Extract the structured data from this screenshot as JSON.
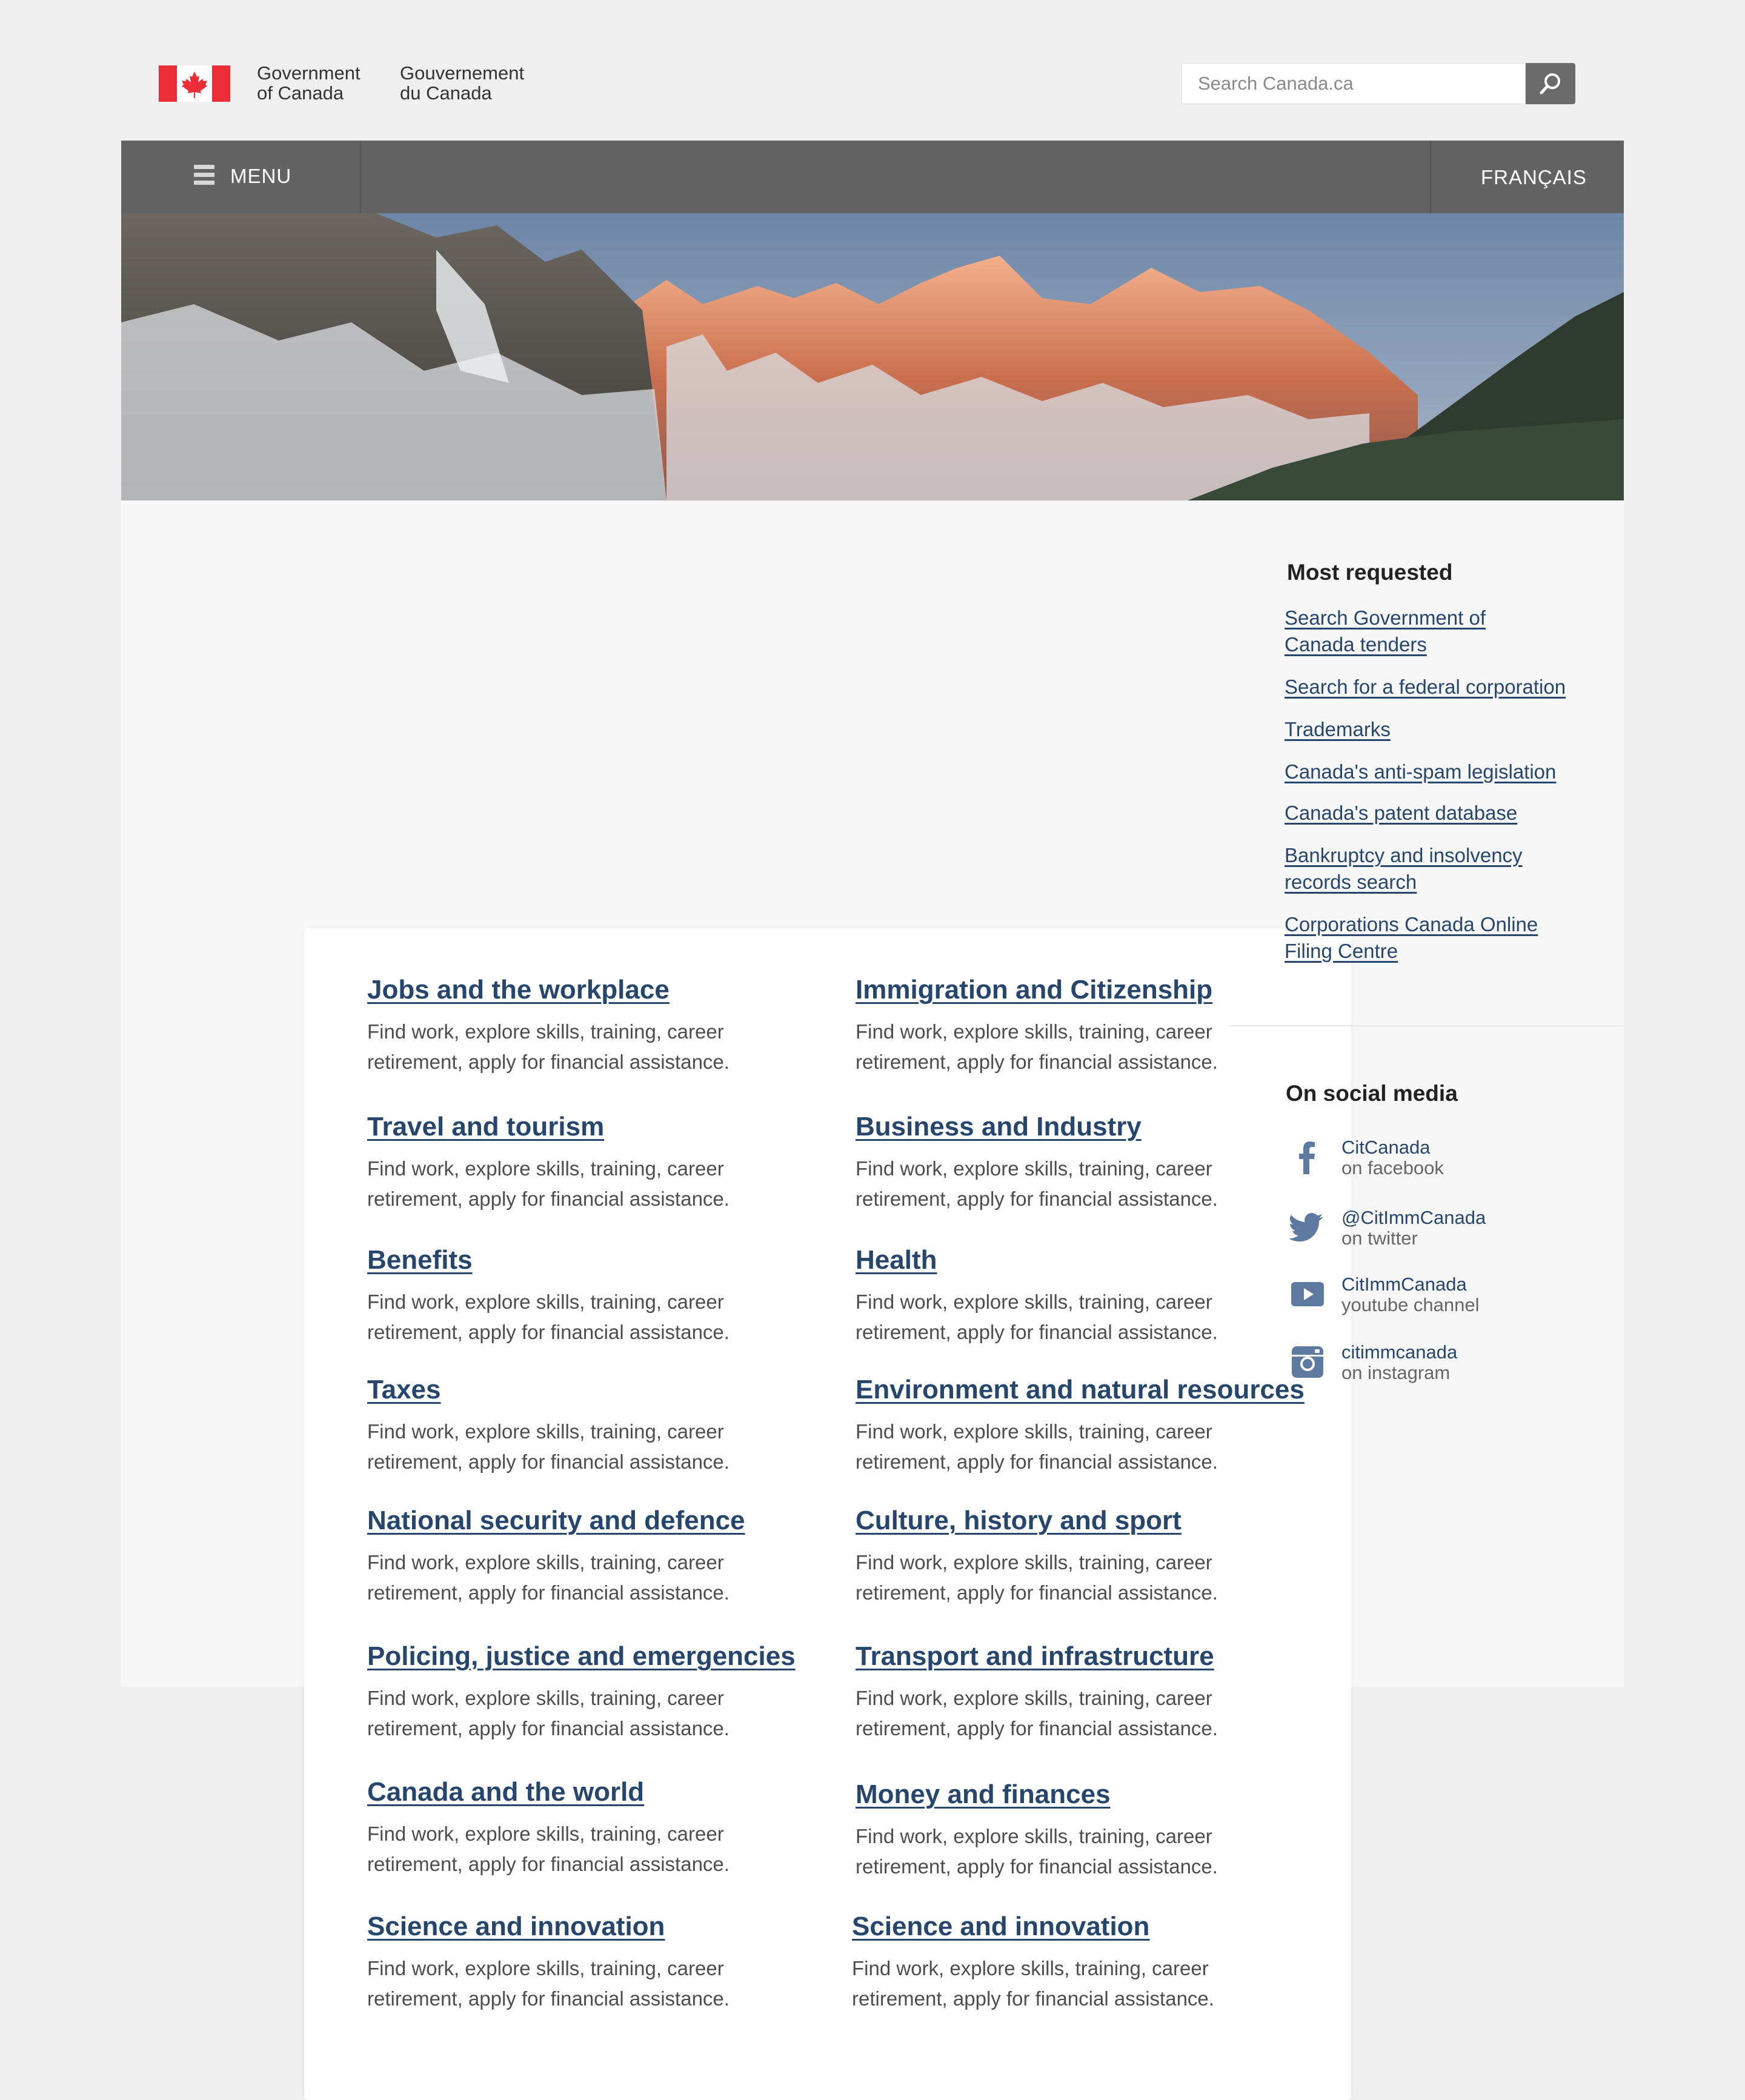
{
  "header": {
    "wordmark_en_line1": "Government",
    "wordmark_en_line2": "of Canada",
    "wordmark_fr_line1": "Gouvernement",
    "wordmark_fr_line2": "du Canada",
    "search_placeholder": "Search Canada.ca",
    "flag_red": "#eb2d37"
  },
  "nav": {
    "menu_label": "MENU",
    "language_label": "FRANÇAIS"
  },
  "colors": {
    "link": "#26466d",
    "navbar": "#636363",
    "page_background": "#efefef"
  },
  "topics": [
    {
      "title": "Jobs and the workplace",
      "desc_line1": "Find work, explore skills, training, career",
      "desc_line2": "retirement, apply for financial assistance."
    },
    {
      "title": "Immigration and Citizenship",
      "desc_line1": "Find work, explore skills, training, career",
      "desc_line2": "retirement, apply for financial assistance."
    },
    {
      "title": "Travel and tourism",
      "desc_line1": "Find work, explore skills, training, career",
      "desc_line2": "retirement, apply for financial assistance."
    },
    {
      "title": "Business and Industry",
      "desc_line1": "Find work, explore skills, training, career",
      "desc_line2": "retirement, apply for financial assistance."
    },
    {
      "title": "Benefits",
      "desc_line1": "Find work, explore skills, training, career",
      "desc_line2": "retirement, apply for financial assistance."
    },
    {
      "title": "Health",
      "desc_line1": "Find work, explore skills, training, career",
      "desc_line2": "retirement, apply for financial assistance."
    },
    {
      "title": "Taxes",
      "desc_line1": "Find work, explore skills, training, career",
      "desc_line2": "retirement, apply for financial assistance."
    },
    {
      "title": "Environment and natural resources",
      "desc_line1": "Find work, explore skills, training, career",
      "desc_line2": "retirement, apply for financial assistance."
    },
    {
      "title": "National security and defence",
      "desc_line1": "Find work, explore skills, training, career",
      "desc_line2": "retirement, apply for financial assistance."
    },
    {
      "title": "Culture, history and sport",
      "desc_line1": "Find work, explore skills, training, career",
      "desc_line2": "retirement, apply for financial assistance."
    },
    {
      "title": "Policing, justice and emergencies",
      "desc_line1": "Find work, explore skills, training, career",
      "desc_line2": "retirement, apply for financial assistance."
    },
    {
      "title": "Transport and infrastructure",
      "desc_line1": "Find work, explore skills, training, career",
      "desc_line2": "retirement, apply for financial assistance."
    },
    {
      "title": "Canada and the world",
      "desc_line1": "Find work, explore skills, training, career",
      "desc_line2": "retirement, apply for financial assistance."
    },
    {
      "title": "Money and finances",
      "desc_line1": "Find work, explore skills, training, career",
      "desc_line2": "retirement, apply for financial assistance."
    },
    {
      "title": "Science and innovation",
      "desc_line1": "Find work, explore skills, training, career",
      "desc_line2": "retirement, apply for financial assistance."
    },
    {
      "title": "Science and innovation",
      "desc_line1": "Find work, explore skills, training, career",
      "desc_line2": "retirement, apply for financial assistance."
    }
  ],
  "most_requested": {
    "title": "Most requested",
    "links": [
      {
        "line1": "Search Government of",
        "line2": "Canada tenders"
      },
      {
        "line1": "Search for a federal corporation",
        "line2": ""
      },
      {
        "line1": "Trademarks",
        "line2": ""
      },
      {
        "line1": "Canada's anti-spam legislation",
        "line2": ""
      },
      {
        "line1": "Canada's patent database",
        "line2": ""
      },
      {
        "line1": "Bankruptcy and insolvency",
        "line2": "records search"
      },
      {
        "line1": "Corporations Canada Online",
        "line2": "Filing Centre"
      }
    ]
  },
  "social_media": {
    "title": "On social media",
    "items": [
      {
        "icon": "facebook-icon",
        "handle": "CitCanada",
        "sub": "on facebook"
      },
      {
        "icon": "twitter-icon",
        "handle": "@CitImmCanada",
        "sub": "on twitter"
      },
      {
        "icon": "youtube-icon",
        "handle": "CitImmCanada",
        "sub": "youtube channel"
      },
      {
        "icon": "instagram-icon",
        "handle": "citimmcanada",
        "sub": "on instagram"
      }
    ]
  }
}
